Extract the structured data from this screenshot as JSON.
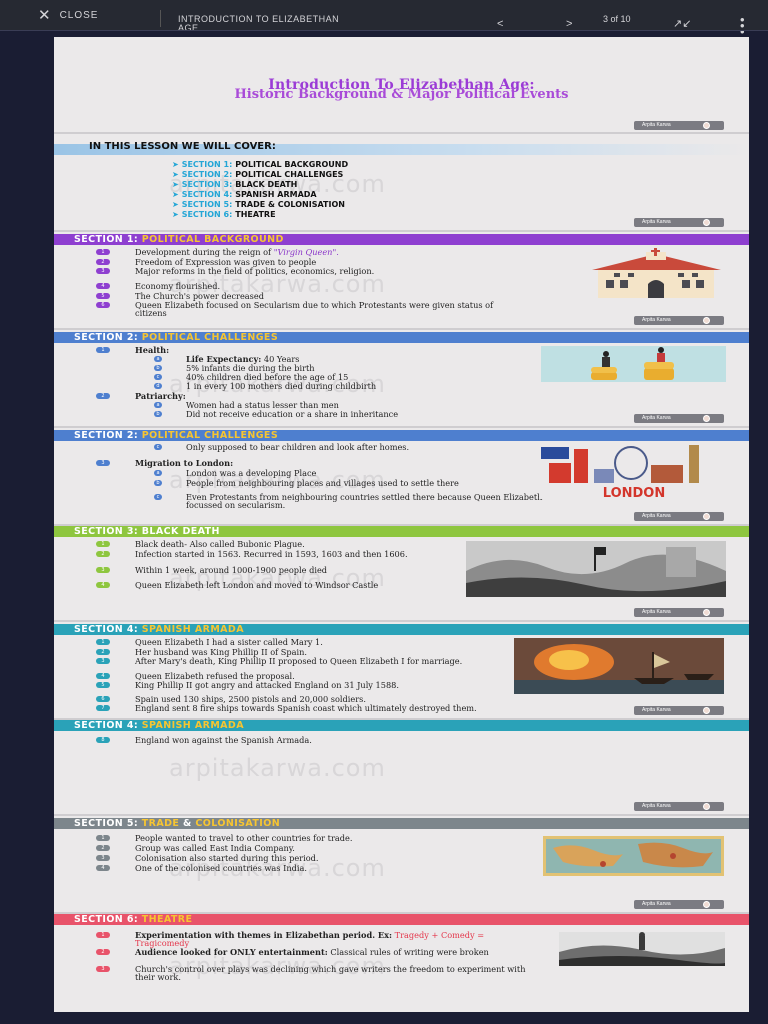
{
  "toolbar": {
    "close_label": "CLOSE",
    "doc_title": "INTRODUCTION TO ELIZABETHAN AGE",
    "prev": "<",
    "next": ">",
    "page_indicator": "3 of 10"
  },
  "badge_name": "Arpita Karwa",
  "watermark": "arpitakarwa.com",
  "slides": {
    "title": {
      "line1": "Introduction To Elizabethan Age:",
      "line2": "Historic Background & Major Political Events"
    },
    "lesson": {
      "heading": "IN THIS LESSON WE WILL COVER:",
      "items": [
        {
          "num": "SECTION 1:",
          "text": "POLITICAL BACKGROUND"
        },
        {
          "num": "SECTION 2:",
          "text": "POLITICAL CHALLENGES"
        },
        {
          "num": "SECTION 3:",
          "text": "BLACK DEATH"
        },
        {
          "num": "SECTION 4:",
          "text": "SPANISH ARMADA"
        },
        {
          "num": "SECTION 5:",
          "text": "TRADE & COLONISATION"
        },
        {
          "num": "SECTION 6:",
          "text": "THEATRE"
        }
      ]
    },
    "s1": {
      "prefix": "SECTION 1:",
      "title": "POLITICAL BACKGROUND",
      "items": [
        {
          "num": "1",
          "text": "Development during the reign of ",
          "extra": "\"Virgin Queen\"."
        },
        {
          "num": "2",
          "text": "Freedom of Expression was given to people"
        },
        {
          "num": "3",
          "text": "Major reforms in the field of politics, economics, religion."
        },
        {
          "num": "4",
          "text": "Economy flourished."
        },
        {
          "num": "5",
          "text": "The Church's power decreased"
        },
        {
          "num": "6",
          "text": "Queen Elizabeth focused on Secularism due to which Protestants were given status of citizens"
        }
      ]
    },
    "s2a": {
      "prefix": "SECTION 2:",
      "title": "POLITICAL CHALLENGES",
      "health": {
        "num": "1",
        "label": "Health:"
      },
      "health_items": [
        {
          "num": "a",
          "label": "Life Expectancy:",
          "text": " 40 Years"
        },
        {
          "num": "b",
          "text": "5% infants die during the birth"
        },
        {
          "num": "c",
          "text": "40% children died before the age of 15"
        },
        {
          "num": "d",
          "text": "1 in every 100 mothers died during childbirth"
        }
      ],
      "patriarchy": {
        "num": "2",
        "label": "Patriarchy:"
      },
      "patriarchy_items": [
        {
          "num": "a",
          "text": "Women had a status lesser than men"
        },
        {
          "num": "b",
          "text": "Did not receive education or a share in inheritance"
        }
      ]
    },
    "s2b": {
      "prefix": "SECTION 2:",
      "title": "POLITICAL CHALLENGES",
      "items_top": [
        {
          "num": "c",
          "text": "Only supposed to bear children and look after homes."
        }
      ],
      "migration": {
        "num": "3",
        "label": "Migration to London:"
      },
      "migration_items": [
        {
          "num": "a",
          "text": "London was a developing Place"
        },
        {
          "num": "b",
          "text": "People from neighbouring places and villages used to settle there"
        },
        {
          "num": "c",
          "text": "Even Protestants from neighbouring countries settled there because Queen Elizabeth focussed on secularism."
        }
      ],
      "london_label": "LONDON"
    },
    "s3": {
      "title": "SECTION 3: BLACK DEATH",
      "items": [
        {
          "num": "1",
          "text": "Black death- Also called Bubonic Plague."
        },
        {
          "num": "2",
          "text": "Infection started in 1563. Recurred in 1593, 1603 and then 1606."
        },
        {
          "num": "3",
          "text": "Within 1 week, around 1000-1900 people died"
        },
        {
          "num": "4",
          "text": "Queen Elizabeth left London and moved to Windsor Castle"
        }
      ]
    },
    "s4a": {
      "prefix": "SECTION 4:",
      "title": "SPANISH ARMADA",
      "items": [
        {
          "num": "1",
          "text": "Queen Elizabeth I had a sister called Mary 1."
        },
        {
          "num": "2",
          "text": "Her husband was King Phillip II of Spain."
        },
        {
          "num": "3",
          "text": "After Mary's death, King Phillip II proposed to Queen Elizabeth I for marriage."
        },
        {
          "num": "4",
          "text": "Queen Elizabeth refused the proposal."
        },
        {
          "num": "5",
          "text": "King Phillip II got angry and attacked England on 31 July 1588."
        },
        {
          "num": "6",
          "text": "Spain used 130 ships, 2500 pistols and 20,000 soldiers."
        },
        {
          "num": "7",
          "text": "England sent 8 fire ships towards Spanish coast which ultimately destroyed them."
        }
      ]
    },
    "s4b": {
      "prefix": "SECTION 4:",
      "title": "SPANISH ARMADA",
      "items": [
        {
          "num": "8",
          "text": "England won against the Spanish Armada."
        }
      ]
    },
    "s5": {
      "prefix": "SECTION 5:",
      "title1": "TRADE",
      "amp": " & ",
      "title2": "COLONISATION",
      "items": [
        {
          "num": "1",
          "text": "People wanted to travel to other countries for trade."
        },
        {
          "num": "2",
          "text": "Group was called East India Company."
        },
        {
          "num": "3",
          "text": "Colonisation also started during this period."
        },
        {
          "num": "4",
          "text": "One of the colonised countries was India."
        }
      ]
    },
    "s6": {
      "prefix": "SECTION 6:",
      "title": "THEATRE",
      "item1": {
        "num": "1",
        "bold": "Experimentation with themes in Elizabethan period. Ex:",
        "red": " Tragedy + Comedy = Tragicomedy"
      },
      "item2": {
        "num": "2",
        "bold": "Audience looked for ONLY entertainment:",
        "text": " Classical rules of writing were broken"
      },
      "item3": {
        "num": "3",
        "text": "Church's control over plays was declining which gave writers the freedom to experiment with their work."
      }
    }
  },
  "colors": {
    "purple": "#8e3fd0",
    "blue": "#4e7fcf",
    "green": "#8ec63f",
    "teal": "#2aa2b8",
    "gray": "#7d868c",
    "red": "#e8536a",
    "highlight": "#f7c531"
  },
  "icons": [
    "close-icon",
    "chevron-left-icon",
    "chevron-right-icon",
    "expand-icon",
    "menu-icon"
  ]
}
